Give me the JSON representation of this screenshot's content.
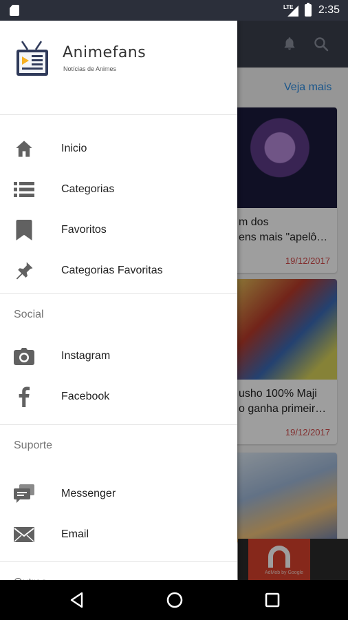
{
  "status_bar": {
    "network": "LTE",
    "time": "2:35"
  },
  "background_app": {
    "see_more": "Veja mais",
    "cards": [
      {
        "title": "m dos",
        "title2": "ens mais \"apelô…",
        "date": "19/12/2017"
      },
      {
        "title": "usho 100% Maji",
        "title2": "o ganha primeir…",
        "date": "19/12/2017"
      }
    ],
    "ad_text": "AdMob by Google"
  },
  "drawer": {
    "app_name": "Animefans",
    "app_subtitle": "Notícias de Animes",
    "main_items": [
      {
        "label": "Inicio",
        "icon": "home-icon"
      },
      {
        "label": "Categorias",
        "icon": "list-icon"
      },
      {
        "label": "Favoritos",
        "icon": "bookmark-icon"
      },
      {
        "label": "Categorias Favoritas",
        "icon": "pin-icon"
      }
    ],
    "social_header": "Social",
    "social_items": [
      {
        "label": "Instagram",
        "icon": "camera-icon"
      },
      {
        "label": "Facebook",
        "icon": "facebook-icon"
      }
    ],
    "support_header": "Suporte",
    "support_items": [
      {
        "label": "Messenger",
        "icon": "chat-icon"
      },
      {
        "label": "Email",
        "icon": "mail-icon"
      }
    ],
    "others_header": "Outros"
  },
  "colors": {
    "icon": "#616161",
    "toolbar": "#3a3f4d",
    "accent": "#2a8be0",
    "date": "#d24b4b"
  }
}
